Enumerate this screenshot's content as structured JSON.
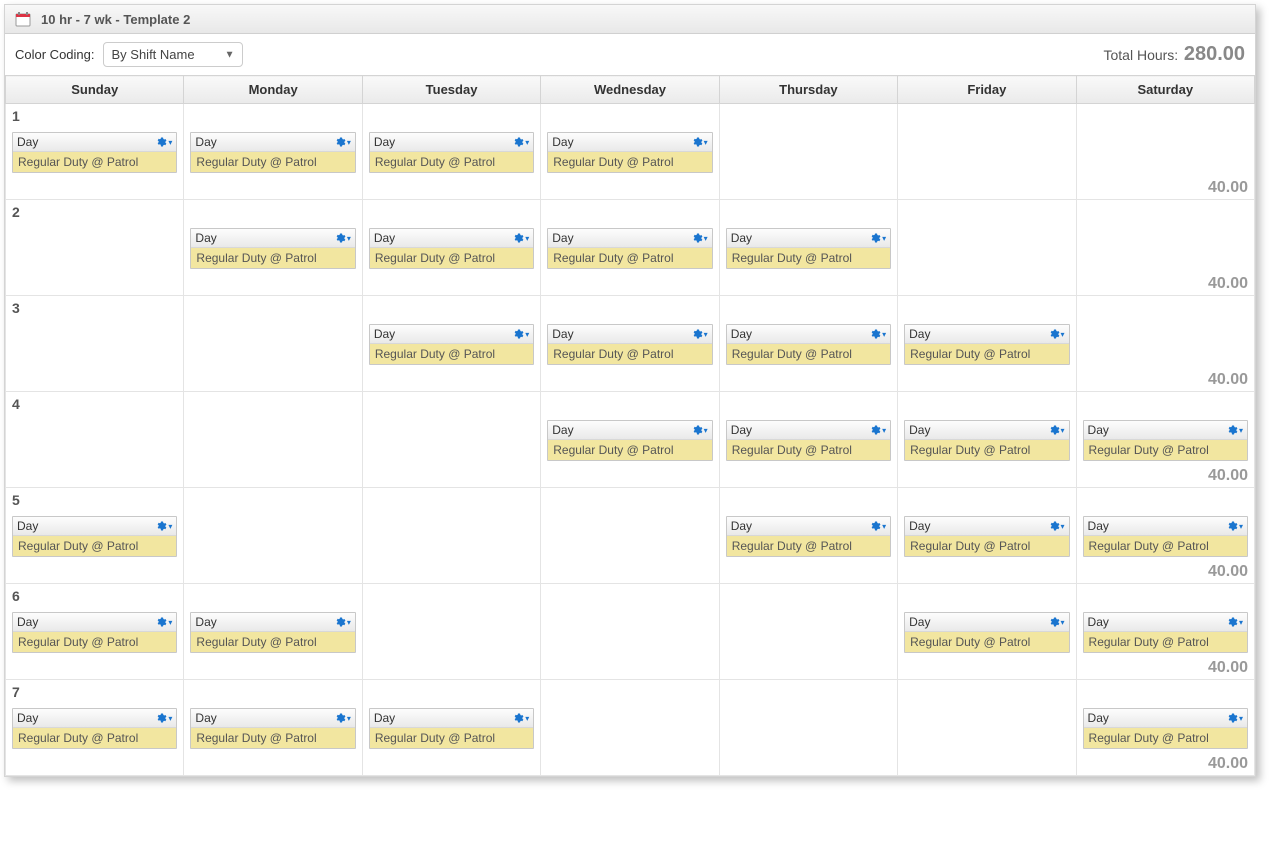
{
  "header": {
    "title": "10 hr - 7 wk - Template 2"
  },
  "toolbar": {
    "color_coding_label": "Color Coding:",
    "color_coding_value": "By Shift Name",
    "total_hours_label": "Total Hours:",
    "total_hours_value": "280.00"
  },
  "days": [
    "Sunday",
    "Monday",
    "Tuesday",
    "Wednesday",
    "Thursday",
    "Friday",
    "Saturday"
  ],
  "shift": {
    "name": "Day",
    "detail": "Regular Duty @ Patrol"
  },
  "weeks": [
    {
      "num": "1",
      "total": "40.00",
      "cells": [
        true,
        true,
        true,
        true,
        false,
        false,
        false
      ]
    },
    {
      "num": "2",
      "total": "40.00",
      "cells": [
        false,
        true,
        true,
        true,
        true,
        false,
        false
      ]
    },
    {
      "num": "3",
      "total": "40.00",
      "cells": [
        false,
        false,
        true,
        true,
        true,
        true,
        false
      ]
    },
    {
      "num": "4",
      "total": "40.00",
      "cells": [
        false,
        false,
        false,
        true,
        true,
        true,
        true
      ]
    },
    {
      "num": "5",
      "total": "40.00",
      "cells": [
        true,
        false,
        false,
        false,
        true,
        true,
        true
      ]
    },
    {
      "num": "6",
      "total": "40.00",
      "cells": [
        true,
        true,
        false,
        false,
        false,
        true,
        true
      ]
    },
    {
      "num": "7",
      "total": "40.00",
      "cells": [
        true,
        true,
        true,
        false,
        false,
        false,
        true
      ]
    }
  ]
}
